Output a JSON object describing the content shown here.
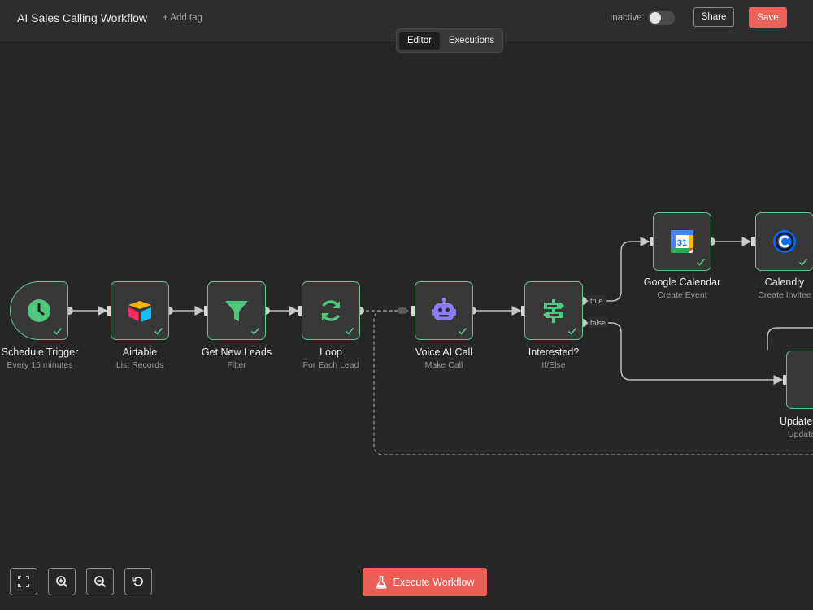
{
  "header": {
    "title": "AI Sales Calling Workflow",
    "add_tag": "+ Add tag",
    "status": "Inactive",
    "share": "Share",
    "save": "Save"
  },
  "tabs": {
    "editor": "Editor",
    "executions": "Executions"
  },
  "nodes": {
    "schedule": {
      "label": "Schedule Trigger",
      "sub": "Every 15 minutes",
      "icon": "clock-icon"
    },
    "airtable": {
      "label": "Airtable",
      "sub": "List Records",
      "icon": "airtable-icon"
    },
    "filter": {
      "label": "Get New Leads",
      "sub": "Filter",
      "icon": "filter-icon"
    },
    "loop": {
      "label": "Loop",
      "sub": "For Each Lead",
      "icon": "loop-icon"
    },
    "voice": {
      "label": "Voice AI Call",
      "sub": "Make Call",
      "icon": "robot-icon"
    },
    "ifelse": {
      "label": "Interested?",
      "sub": "If/Else",
      "icon": "signpost-icon"
    },
    "gcal": {
      "label": "Google Calendar",
      "sub": "Create Event",
      "icon": "google-calendar-icon",
      "day": "31"
    },
    "calendly": {
      "label": "Calendly",
      "sub": "Create Invitee",
      "icon": "calendly-icon"
    },
    "update": {
      "label": "Update",
      "sub": "Update",
      "icon": "airtable-icon"
    }
  },
  "branches": {
    "true": "true",
    "false": "false"
  },
  "controls": {
    "execute": "Execute Workflow"
  },
  "colors": {
    "accent_green": "#62c48b",
    "save_red": "#e8625a",
    "canvas": "#262626"
  }
}
